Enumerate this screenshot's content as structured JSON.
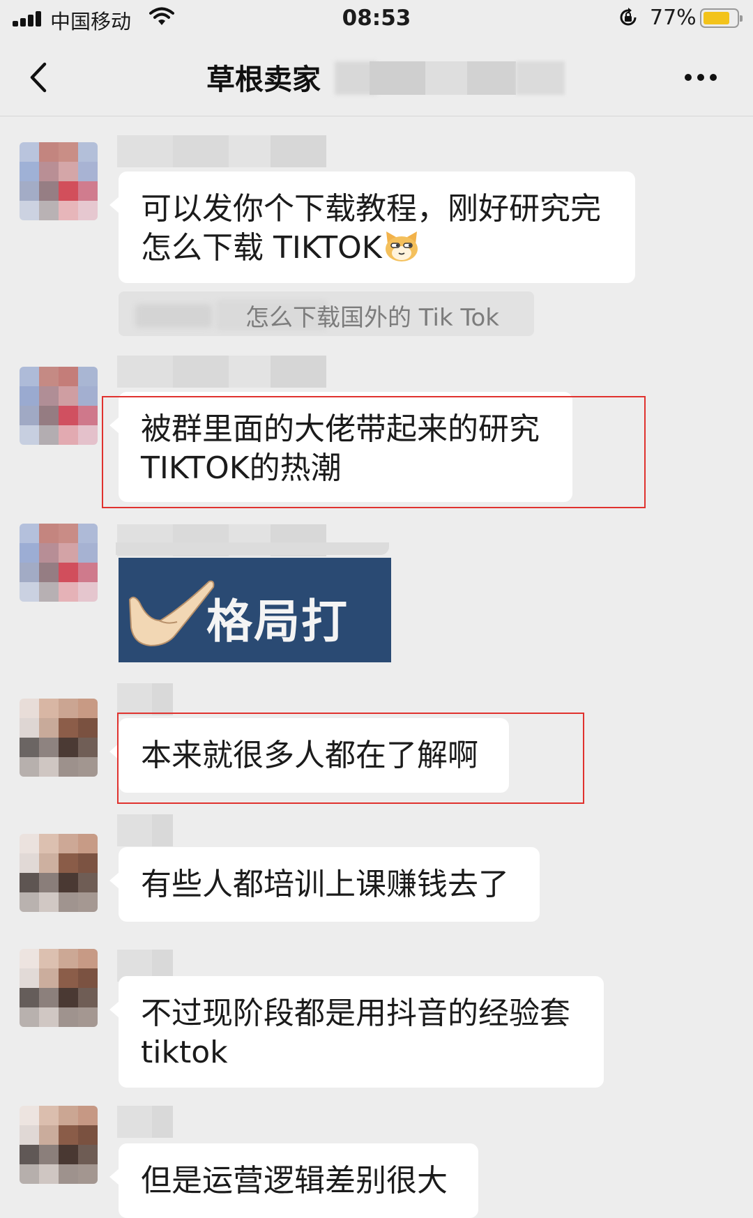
{
  "status_bar": {
    "carrier": "中国移动",
    "time": "08:53",
    "battery_pct": "77%",
    "battery_level": 0.77,
    "battery_color": "#f3c31b"
  },
  "nav": {
    "title": "草根卖家"
  },
  "messages": [
    {
      "kind": "text",
      "text": "可以发你个下载教程，刚好研究完\n怎么下载 TIKTOK",
      "emoji": "cat-face"
    },
    {
      "kind": "quote",
      "text": "怎么下载国外的 Tik Tok"
    },
    {
      "kind": "text",
      "text": "被群里面的大佬带起来的研究\nTIKTOK的热潮",
      "highlighted": true
    },
    {
      "kind": "sticker",
      "text": "格局打开"
    },
    {
      "kind": "text",
      "text": "本来就很多人都在了解啊",
      "highlighted": true
    },
    {
      "kind": "text",
      "text": "有些人都培训上课赚钱去了"
    },
    {
      "kind": "text",
      "text": "不过现阶段都是用抖音的经验套\ntiktok"
    },
    {
      "kind": "text",
      "text": "但是运营逻辑差别很大"
    }
  ],
  "colors": {
    "background": "#ededed",
    "bubble": "#ffffff",
    "highlight_border": "#e0322e",
    "sticker_bg": "#2a4a73"
  }
}
